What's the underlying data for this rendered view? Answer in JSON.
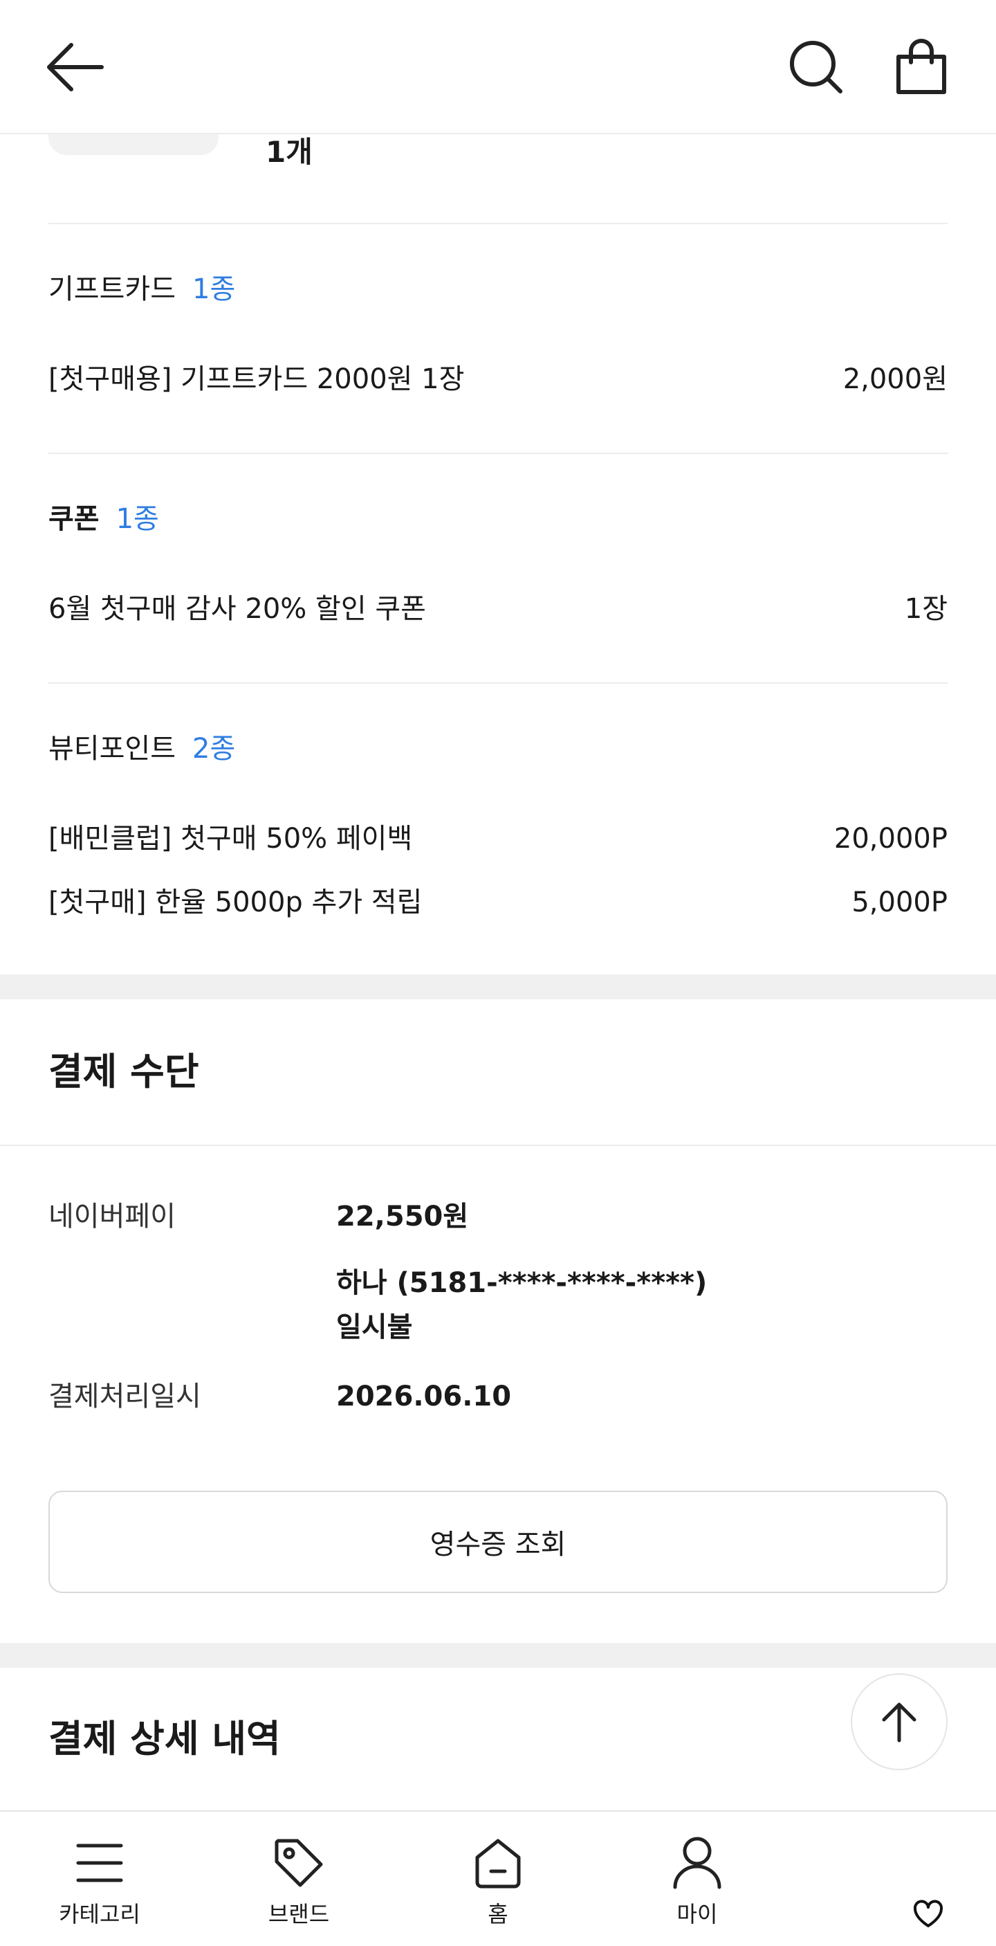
{
  "previous_item": {
    "quantity": "1개"
  },
  "giftcard": {
    "label": "기프트카드",
    "count": "1종",
    "items": [
      {
        "name": "[첫구매용] 기프트카드 2000원 1장",
        "value": "2,000원"
      }
    ]
  },
  "coupon": {
    "label": "쿠폰",
    "count": "1종",
    "items": [
      {
        "name": "6월 첫구매 감사 20% 할인 쿠폰",
        "value": "1장"
      }
    ]
  },
  "beauty_point": {
    "label": "뷰티포인트",
    "count": "2종",
    "items": [
      {
        "name": "[배민클럽] 첫구매 50% 페이백",
        "value": "20,000P"
      },
      {
        "name": "[첫구매] 한율 5000p 추가 적립",
        "value": "5,000P"
      }
    ]
  },
  "payment_method": {
    "title": "결제 수단",
    "method_label": "네이버페이",
    "amount": "22,550원",
    "card": "하나 (5181-****-****-****)",
    "installment": "일시불",
    "date_label": "결제처리일시",
    "date_value": "2026.06.10",
    "receipt_button": "영수증 조회"
  },
  "payment_detail": {
    "title": "결제 상세 내역"
  },
  "bottom_nav": {
    "items": [
      {
        "label": "카테고리",
        "icon": "menu-icon"
      },
      {
        "label": "브랜드",
        "icon": "tag-icon"
      },
      {
        "label": "홈",
        "icon": "home-icon"
      },
      {
        "label": "마이",
        "icon": "user-icon"
      }
    ]
  },
  "colors": {
    "accent": "#2f7de1",
    "section_gap": "#f0f0f0",
    "divider": "#ececec"
  }
}
